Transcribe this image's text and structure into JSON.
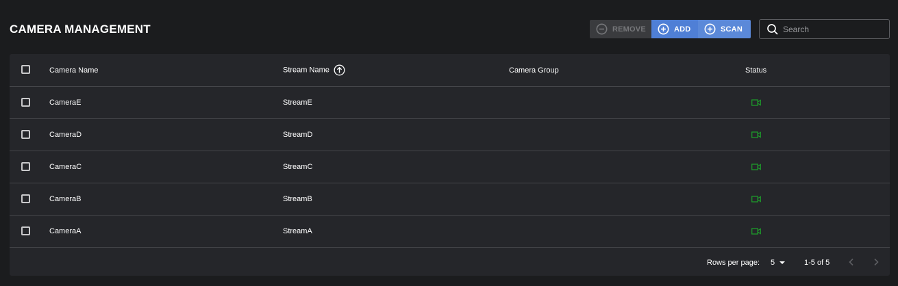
{
  "page": {
    "title": "CAMERA MANAGEMENT"
  },
  "toolbar": {
    "remove_label": "REMOVE",
    "add_label": "ADD",
    "scan_label": "SCAN",
    "remove_icon": "minus-circle-icon",
    "add_icon": "plus-circle-icon",
    "scan_icon": "plus-circle-icon"
  },
  "search": {
    "placeholder": "Search",
    "value": ""
  },
  "table": {
    "columns": [
      "Camera Name",
      "Stream Name",
      "Camera Group",
      "Status"
    ],
    "sort": {
      "column": "Stream Name",
      "icon": "arrow-up-circle-icon"
    },
    "rows": [
      {
        "camera": "CameraE",
        "stream": "StreamE",
        "group": "",
        "status_icon": "video-camera-icon"
      },
      {
        "camera": "CameraD",
        "stream": "StreamD",
        "group": "",
        "status_icon": "video-camera-icon"
      },
      {
        "camera": "CameraC",
        "stream": "StreamC",
        "group": "",
        "status_icon": "video-camera-icon"
      },
      {
        "camera": "CameraB",
        "stream": "StreamB",
        "group": "",
        "status_icon": "video-camera-icon"
      },
      {
        "camera": "CameraA",
        "stream": "StreamA",
        "group": "",
        "status_icon": "video-camera-icon"
      }
    ]
  },
  "pagination": {
    "rows_per_page_label": "Rows per page:",
    "rows_per_page": "5",
    "range": "1-5 of 5"
  },
  "colors": {
    "background": "#1b1c1e",
    "card": "#25262a",
    "accent": "#4f7fd6",
    "status_online": "#1e9a2a"
  }
}
